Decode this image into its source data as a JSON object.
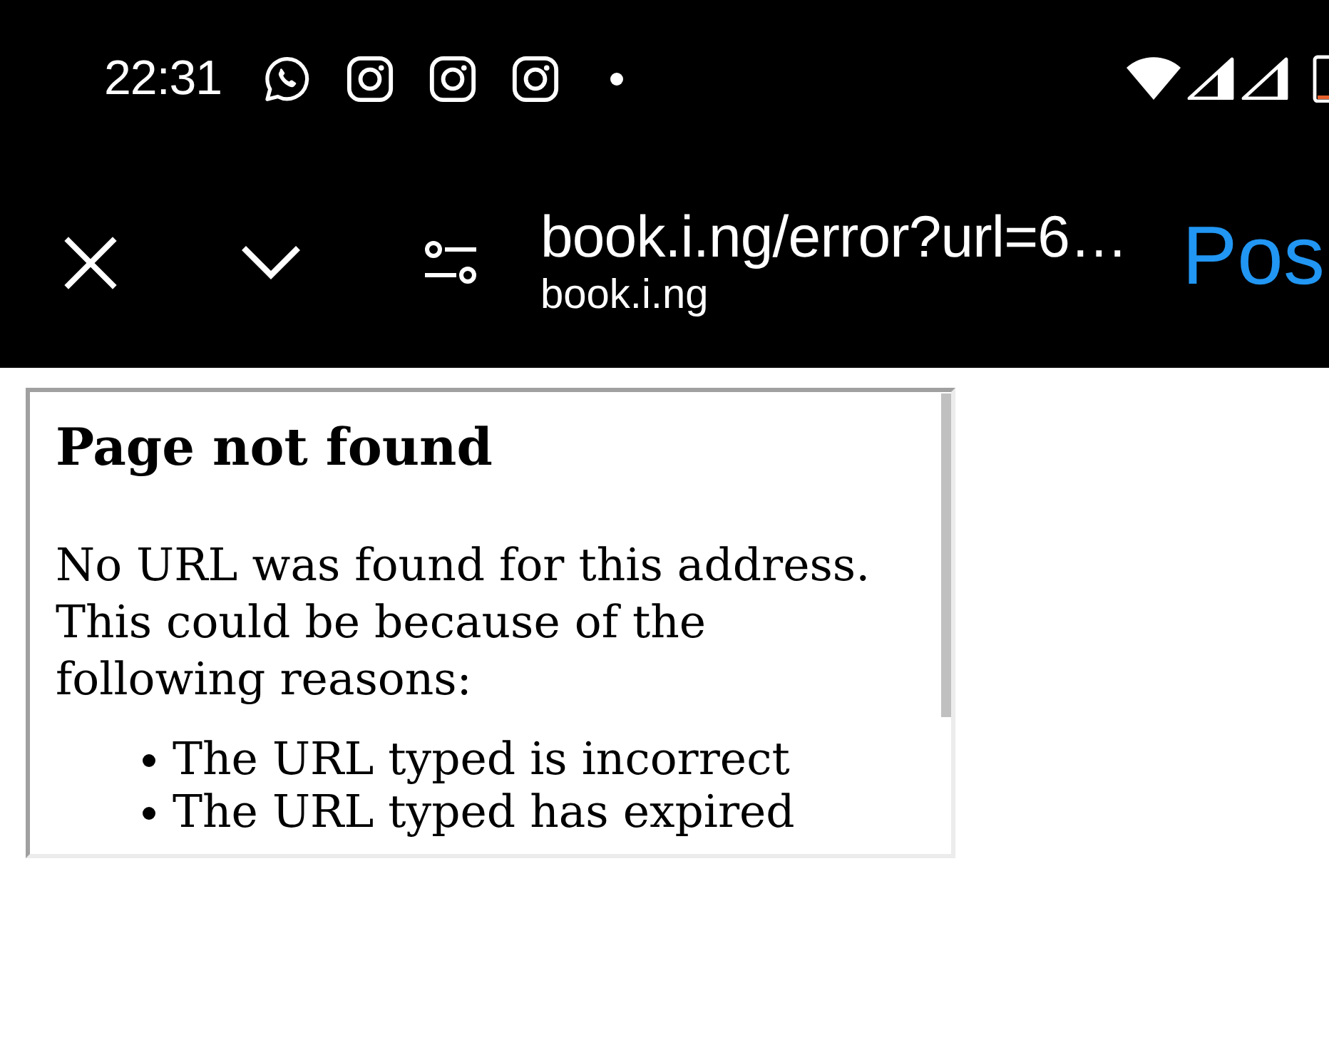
{
  "status_bar": {
    "time": "22:31"
  },
  "toolbar": {
    "title": "book.i.ng/error?url=6…",
    "subtitle": "book.i.ng",
    "action": "Pos"
  },
  "page": {
    "heading": "Page not found",
    "message": "No URL was found for this address. This could be because of the following reasons:",
    "reasons": [
      "The URL typed is incorrect",
      "The URL typed has expired"
    ]
  }
}
